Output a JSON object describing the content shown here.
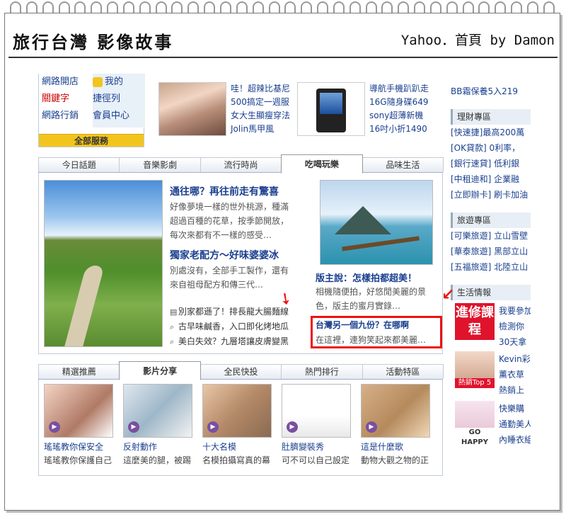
{
  "header": {
    "title": "旅行台灣 影像故事",
    "right": "Yahoo．首頁 by Damon"
  },
  "services": {
    "col1": [
      "網路開店",
      "關鍵字",
      "網路行銷"
    ],
    "col2": [
      "我的",
      "捷徑列",
      "會員中心"
    ],
    "all": "全部服務"
  },
  "ads": [
    {
      "lines": [
        "哇！超辣比基尼",
        "500搞定一週服",
        "女大生顯瘦穿法",
        "Jolin馬甲風"
      ]
    },
    {
      "lines": [
        "導航手機趴趴走",
        "16G隨身碟649",
        "sony超薄新機",
        "16吋小折1490"
      ]
    }
  ],
  "right_col": {
    "top_item": "BB霜保養5入219",
    "finance": {
      "title": "理財專區",
      "items": [
        "[快速捷]最高200萬",
        "[OK貸款] 0利率，",
        "[銀行速貸] 低利銀",
        "[中租迪和] 企業融",
        "[立即辦卡] 刷卡加油"
      ]
    },
    "travel": {
      "title": "旅遊專區",
      "items": [
        "[可樂旅遊] 立山雪壁",
        "[華泰旅遊] 黑部立山",
        "[五福旅遊] 北陸立山"
      ]
    },
    "life": {
      "title": "生活情報",
      "promo1_text": "進修課程",
      "promo1_lines": [
        "我要參加",
        "檢測你",
        "30天拿"
      ],
      "promo2_badge": "熱銷Top 5",
      "promo2_lines": [
        "Kevin彩",
        "薰衣草",
        "熱銷上"
      ],
      "promo3_badge": "GO HAPPY",
      "promo3_lines": [
        "快樂購",
        "通勤美人",
        "內睡衣組"
      ]
    }
  },
  "tabs_top": {
    "items": [
      "今日話題",
      "音樂影劇",
      "流行時尚",
      "吃喝玩樂",
      "品味生活"
    ],
    "active": 3
  },
  "stories": {
    "s1_title": "通往哪？再往前走有驚喜",
    "s1_text": [
      "好像夢境一樣的世外桃源，種滿",
      "超過百種的花草，按季節開放，",
      "每次來都有不一樣的感受…"
    ],
    "s2_title": "獨家老配方～好味婆婆冰",
    "s2_text": [
      "別處沒有，全部手工製作，還有",
      "來自祖母配方和傳三代…"
    ],
    "bullets": [
      "別家都遜了！排長龍大腸麵線",
      "古早味鹹香，入口即化烤地瓜",
      "美白失效？九層塔讓皮膚變黑"
    ],
    "s3_title": "版主說：怎樣拍都超美！",
    "s3_text": [
      "相機隨便拍，好悠閒美麗的景",
      "色，版主的蜜月實錄…"
    ],
    "s4_title": "台灣另一個九份？在哪啊",
    "s4_text": "在這裡，連狗笑起來都美麗…"
  },
  "tabs_bottom": {
    "items": [
      "精選推薦",
      "影片分享",
      "全民快投",
      "熱門排行",
      "活動特區"
    ],
    "active": 1
  },
  "videos": [
    {
      "title": "瑤瑤教你保安全",
      "desc": "瑤瑤教你保護自己"
    },
    {
      "title": "反射動作",
      "desc": "這麼美的腿，被踢"
    },
    {
      "title": "十大名模",
      "desc": "名模拍攝寫真的幕"
    },
    {
      "title": "肚臍變裝秀",
      "desc": "可不可以自己設定"
    },
    {
      "title": "這是什麼歌",
      "desc": "動物大觀之物的正"
    }
  ],
  "colors": {
    "link": "#1a3f8f",
    "highlight": "#e11111",
    "accent": "#f2c51e"
  }
}
